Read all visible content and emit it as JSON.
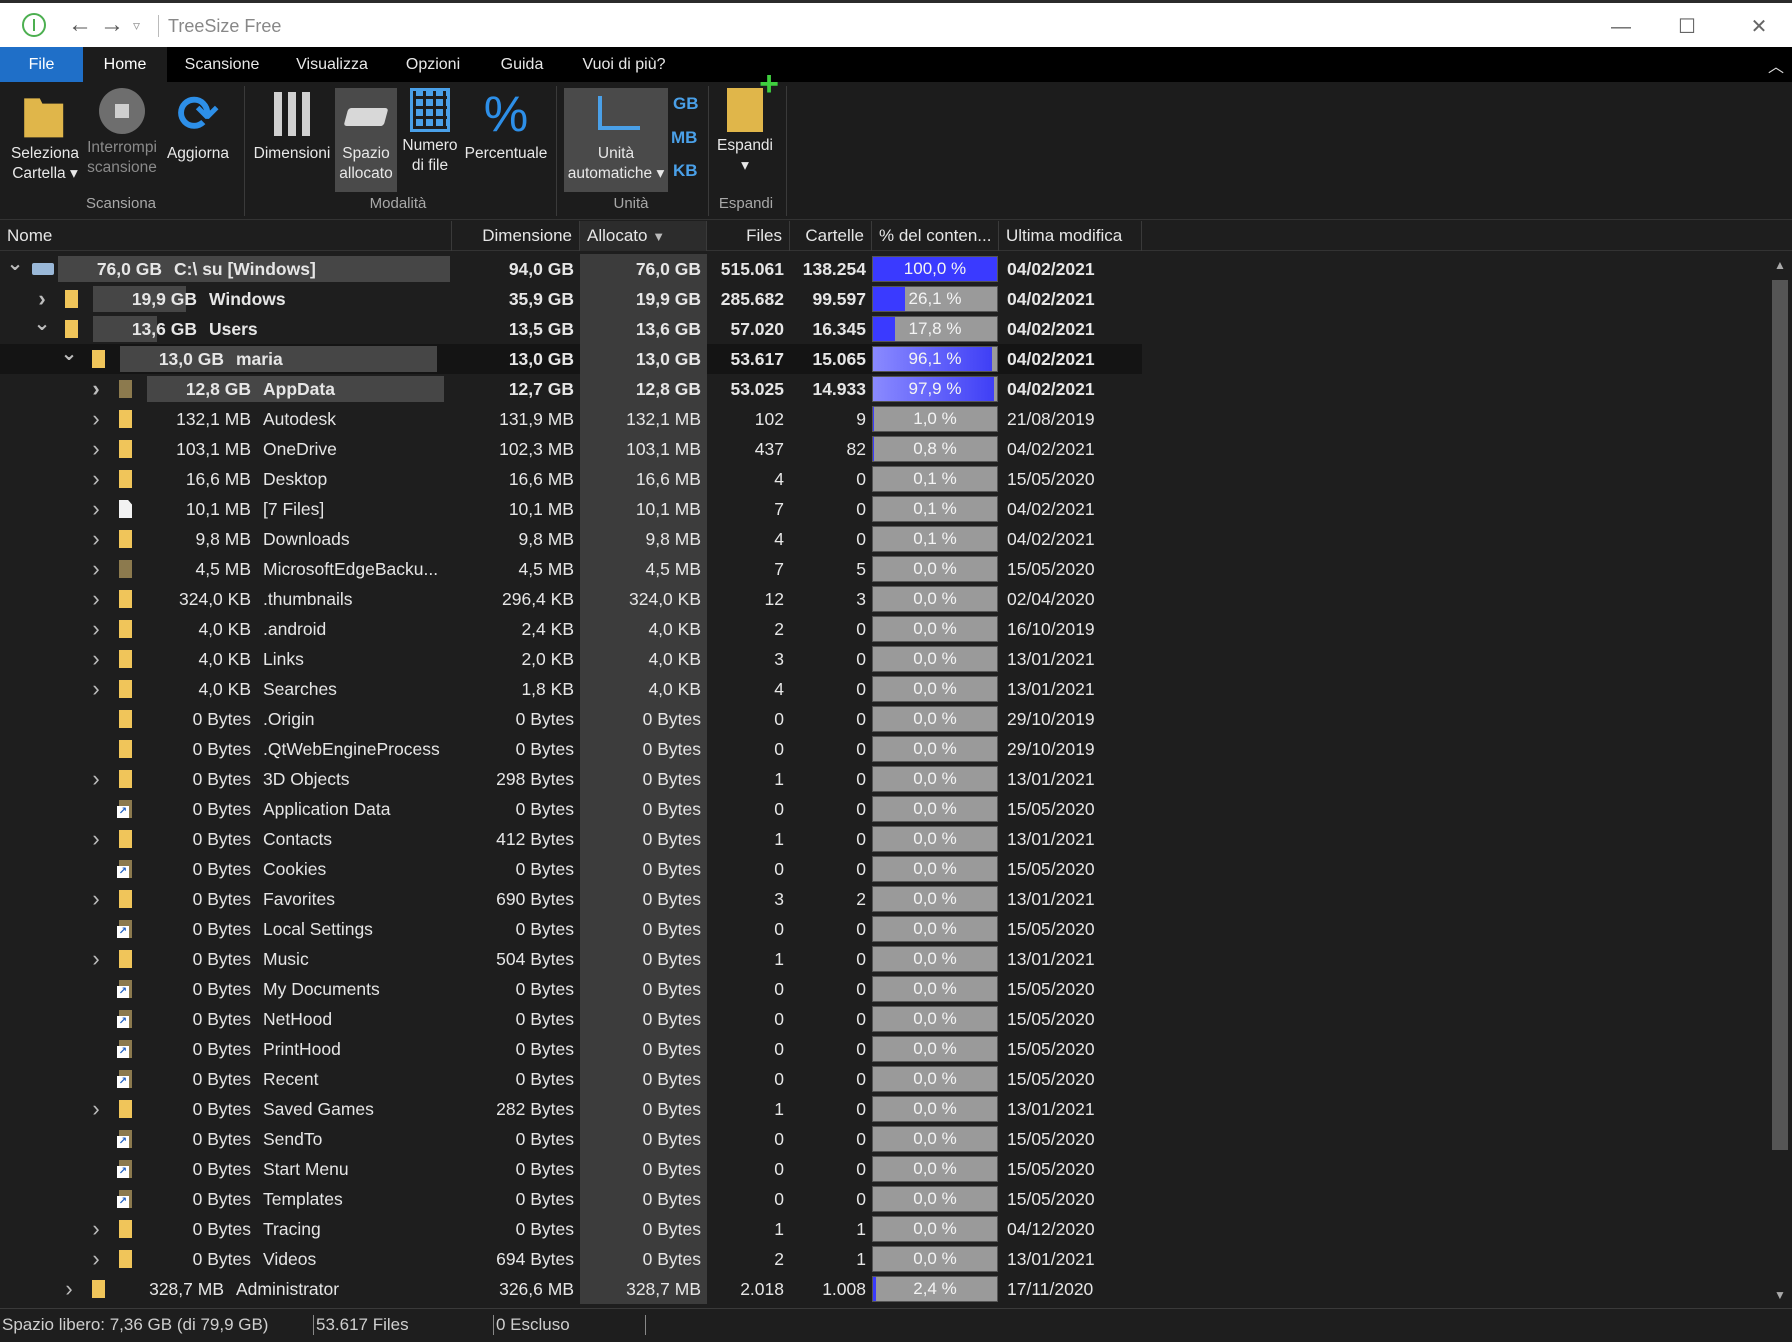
{
  "window": {
    "title": "TreeSize Free"
  },
  "menu": {
    "tabs": [
      "File",
      "Home",
      "Scansione",
      "Visualizza",
      "Opzioni",
      "Guida",
      "Vuoi di più?"
    ],
    "active": "Home"
  },
  "ribbon": {
    "select_folder": "Seleziona Cartella",
    "select_folder_l1": "Seleziona",
    "select_folder_l2": "Cartella",
    "stop_l1": "Interrompi",
    "stop_l2": "scansione",
    "refresh": "Aggiorna",
    "size": "Dimensioni",
    "alloc_l1": "Spazio",
    "alloc_l2": "allocato",
    "files_l1": "Numero",
    "files_l2": "di file",
    "percent": "Percentuale",
    "units_l1": "Unità",
    "units_l2": "automatiche",
    "unit_gb": "GB",
    "unit_mb": "MB",
    "unit_kb": "KB",
    "expand": "Espandi",
    "groups": {
      "scan": "Scansiona",
      "mode": "Modalità",
      "unit": "Unità",
      "expand": "Espandi"
    }
  },
  "columns": {
    "name": "Nome",
    "size": "Dimensione",
    "allocated": "Allocato",
    "files": "Files",
    "folders": "Cartelle",
    "percent": "% del conten...",
    "modified": "Ultima modifica"
  },
  "rows": [
    {
      "level": 0,
      "chev": "v",
      "icon": "drive",
      "bar": 1.0,
      "alloc": "76,0 GB",
      "name": "C:\\  su  [Windows]",
      "size": "94,0 GB",
      "allocated": "76,0 GB",
      "files": "515.061",
      "folders": "138.254",
      "pct": 1.0,
      "pct_label": "100,0 %",
      "date": "04/02/2021",
      "bold": true
    },
    {
      "level": 1,
      "chev": ">",
      "icon": "folder",
      "bar": 0.261,
      "alloc": "19,9 GB",
      "name": "Windows",
      "size": "35,9 GB",
      "allocated": "19,9 GB",
      "files": "285.682",
      "folders": "99.597",
      "pct": 0.261,
      "pct_label": "26,1 %",
      "date": "04/02/2021",
      "bold": true
    },
    {
      "level": 1,
      "chev": "v",
      "icon": "folder",
      "bar": 0.178,
      "alloc": "13,6 GB",
      "name": "Users",
      "size": "13,5 GB",
      "allocated": "13,6 GB",
      "files": "57.020",
      "folders": "16.345",
      "pct": 0.178,
      "pct_label": "17,8 %",
      "date": "04/02/2021",
      "bold": true
    },
    {
      "level": 2,
      "chev": "v",
      "icon": "folder",
      "bar": 0.961,
      "alloc": "13,0 GB",
      "name": "maria",
      "size": "13,0 GB",
      "allocated": "13,0 GB",
      "files": "53.617",
      "folders": "15.065",
      "pct": 0.961,
      "pct_label": "96,1 %",
      "date": "04/02/2021",
      "bold": true,
      "selected": true
    },
    {
      "level": 3,
      "chev": ">",
      "icon": "folder-dark",
      "bar": 0.979,
      "alloc": "12,8 GB",
      "name": "AppData",
      "size": "12,7 GB",
      "allocated": "12,8 GB",
      "files": "53.025",
      "folders": "14.933",
      "pct": 0.979,
      "pct_label": "97,9 %",
      "date": "04/02/2021",
      "bold": true
    },
    {
      "level": 3,
      "chev": ">",
      "icon": "folder",
      "bar": 0.01,
      "alloc": "132,1 MB",
      "name": "Autodesk",
      "size": "131,9 MB",
      "allocated": "132,1 MB",
      "files": "102",
      "folders": "9",
      "pct": 0.01,
      "pct_label": "1,0 %",
      "date": "21/08/2019"
    },
    {
      "level": 3,
      "chev": ">",
      "icon": "folder",
      "bar": 0.008,
      "alloc": "103,1 MB",
      "name": "OneDrive",
      "size": "102,3 MB",
      "allocated": "103,1 MB",
      "files": "437",
      "folders": "82",
      "pct": 0.008,
      "pct_label": "0,8 %",
      "date": "04/02/2021"
    },
    {
      "level": 3,
      "chev": ">",
      "icon": "folder",
      "bar": 0.001,
      "alloc": "16,6 MB",
      "name": "Desktop",
      "size": "16,6 MB",
      "allocated": "16,6 MB",
      "files": "4",
      "folders": "0",
      "pct": 0.001,
      "pct_label": "0,1 %",
      "date": "15/05/2020"
    },
    {
      "level": 3,
      "chev": ">",
      "icon": "file",
      "bar": 0.001,
      "alloc": "10,1 MB",
      "name": "[7 Files]",
      "size": "10,1 MB",
      "allocated": "10,1 MB",
      "files": "7",
      "folders": "0",
      "pct": 0.001,
      "pct_label": "0,1 %",
      "date": "04/02/2021"
    },
    {
      "level": 3,
      "chev": ">",
      "icon": "folder",
      "bar": 0.001,
      "alloc": "9,8 MB",
      "name": "Downloads",
      "size": "9,8 MB",
      "allocated": "9,8 MB",
      "files": "4",
      "folders": "0",
      "pct": 0.001,
      "pct_label": "0,1 %",
      "date": "04/02/2021"
    },
    {
      "level": 3,
      "chev": ">",
      "icon": "folder-dark",
      "bar": 0.0,
      "alloc": "4,5 MB",
      "name": "MicrosoftEdgeBacku...",
      "size": "4,5 MB",
      "allocated": "4,5 MB",
      "files": "7",
      "folders": "5",
      "pct": 0.0,
      "pct_label": "0,0 %",
      "date": "15/05/2020"
    },
    {
      "level": 3,
      "chev": ">",
      "icon": "folder",
      "bar": 0.0,
      "alloc": "324,0 KB",
      "name": ".thumbnails",
      "size": "296,4 KB",
      "allocated": "324,0 KB",
      "files": "12",
      "folders": "3",
      "pct": 0.0,
      "pct_label": "0,0 %",
      "date": "02/04/2020"
    },
    {
      "level": 3,
      "chev": ">",
      "icon": "folder",
      "bar": 0.0,
      "alloc": "4,0 KB",
      "name": ".android",
      "size": "2,4 KB",
      "allocated": "4,0 KB",
      "files": "2",
      "folders": "0",
      "pct": 0.0,
      "pct_label": "0,0 %",
      "date": "16/10/2019"
    },
    {
      "level": 3,
      "chev": ">",
      "icon": "folder",
      "bar": 0.0,
      "alloc": "4,0 KB",
      "name": "Links",
      "size": "2,0 KB",
      "allocated": "4,0 KB",
      "files": "3",
      "folders": "0",
      "pct": 0.0,
      "pct_label": "0,0 %",
      "date": "13/01/2021"
    },
    {
      "level": 3,
      "chev": ">",
      "icon": "folder",
      "bar": 0.0,
      "alloc": "4,0 KB",
      "name": "Searches",
      "size": "1,8 KB",
      "allocated": "4,0 KB",
      "files": "4",
      "folders": "0",
      "pct": 0.0,
      "pct_label": "0,0 %",
      "date": "13/01/2021"
    },
    {
      "level": 3,
      "chev": "",
      "icon": "folder",
      "bar": 0.0,
      "alloc": "0 Bytes",
      "name": ".Origin",
      "size": "0 Bytes",
      "allocated": "0 Bytes",
      "files": "0",
      "folders": "0",
      "pct": 0.0,
      "pct_label": "0,0 %",
      "date": "29/10/2019"
    },
    {
      "level": 3,
      "chev": "",
      "icon": "folder",
      "bar": 0.0,
      "alloc": "0 Bytes",
      "name": ".QtWebEngineProcess",
      "size": "0 Bytes",
      "allocated": "0 Bytes",
      "files": "0",
      "folders": "0",
      "pct": 0.0,
      "pct_label": "0,0 %",
      "date": "29/10/2019"
    },
    {
      "level": 3,
      "chev": ">",
      "icon": "folder",
      "bar": 0.0,
      "alloc": "0 Bytes",
      "name": "3D Objects",
      "size": "298 Bytes",
      "allocated": "0 Bytes",
      "files": "1",
      "folders": "0",
      "pct": 0.0,
      "pct_label": "0,0 %",
      "date": "13/01/2021"
    },
    {
      "level": 3,
      "chev": "",
      "icon": "link",
      "bar": 0.0,
      "alloc": "0 Bytes",
      "name": "Application Data",
      "size": "0 Bytes",
      "allocated": "0 Bytes",
      "files": "0",
      "folders": "0",
      "pct": 0.0,
      "pct_label": "0,0 %",
      "date": "15/05/2020"
    },
    {
      "level": 3,
      "chev": ">",
      "icon": "folder",
      "bar": 0.0,
      "alloc": "0 Bytes",
      "name": "Contacts",
      "size": "412 Bytes",
      "allocated": "0 Bytes",
      "files": "1",
      "folders": "0",
      "pct": 0.0,
      "pct_label": "0,0 %",
      "date": "13/01/2021"
    },
    {
      "level": 3,
      "chev": "",
      "icon": "link",
      "bar": 0.0,
      "alloc": "0 Bytes",
      "name": "Cookies",
      "size": "0 Bytes",
      "allocated": "0 Bytes",
      "files": "0",
      "folders": "0",
      "pct": 0.0,
      "pct_label": "0,0 %",
      "date": "15/05/2020"
    },
    {
      "level": 3,
      "chev": ">",
      "icon": "folder",
      "bar": 0.0,
      "alloc": "0 Bytes",
      "name": "Favorites",
      "size": "690 Bytes",
      "allocated": "0 Bytes",
      "files": "3",
      "folders": "2",
      "pct": 0.0,
      "pct_label": "0,0 %",
      "date": "13/01/2021"
    },
    {
      "level": 3,
      "chev": "",
      "icon": "link",
      "bar": 0.0,
      "alloc": "0 Bytes",
      "name": "Local Settings",
      "size": "0 Bytes",
      "allocated": "0 Bytes",
      "files": "0",
      "folders": "0",
      "pct": 0.0,
      "pct_label": "0,0 %",
      "date": "15/05/2020"
    },
    {
      "level": 3,
      "chev": ">",
      "icon": "folder",
      "bar": 0.0,
      "alloc": "0 Bytes",
      "name": "Music",
      "size": "504 Bytes",
      "allocated": "0 Bytes",
      "files": "1",
      "folders": "0",
      "pct": 0.0,
      "pct_label": "0,0 %",
      "date": "13/01/2021"
    },
    {
      "level": 3,
      "chev": "",
      "icon": "link",
      "bar": 0.0,
      "alloc": "0 Bytes",
      "name": "My Documents",
      "size": "0 Bytes",
      "allocated": "0 Bytes",
      "files": "0",
      "folders": "0",
      "pct": 0.0,
      "pct_label": "0,0 %",
      "date": "15/05/2020"
    },
    {
      "level": 3,
      "chev": "",
      "icon": "link",
      "bar": 0.0,
      "alloc": "0 Bytes",
      "name": "NetHood",
      "size": "0 Bytes",
      "allocated": "0 Bytes",
      "files": "0",
      "folders": "0",
      "pct": 0.0,
      "pct_label": "0,0 %",
      "date": "15/05/2020"
    },
    {
      "level": 3,
      "chev": "",
      "icon": "link",
      "bar": 0.0,
      "alloc": "0 Bytes",
      "name": "PrintHood",
      "size": "0 Bytes",
      "allocated": "0 Bytes",
      "files": "0",
      "folders": "0",
      "pct": 0.0,
      "pct_label": "0,0 %",
      "date": "15/05/2020"
    },
    {
      "level": 3,
      "chev": "",
      "icon": "link",
      "bar": 0.0,
      "alloc": "0 Bytes",
      "name": "Recent",
      "size": "0 Bytes",
      "allocated": "0 Bytes",
      "files": "0",
      "folders": "0",
      "pct": 0.0,
      "pct_label": "0,0 %",
      "date": "15/05/2020"
    },
    {
      "level": 3,
      "chev": ">",
      "icon": "folder",
      "bar": 0.0,
      "alloc": "0 Bytes",
      "name": "Saved Games",
      "size": "282 Bytes",
      "allocated": "0 Bytes",
      "files": "1",
      "folders": "0",
      "pct": 0.0,
      "pct_label": "0,0 %",
      "date": "13/01/2021"
    },
    {
      "level": 3,
      "chev": "",
      "icon": "link",
      "bar": 0.0,
      "alloc": "0 Bytes",
      "name": "SendTo",
      "size": "0 Bytes",
      "allocated": "0 Bytes",
      "files": "0",
      "folders": "0",
      "pct": 0.0,
      "pct_label": "0,0 %",
      "date": "15/05/2020"
    },
    {
      "level": 3,
      "chev": "",
      "icon": "link",
      "bar": 0.0,
      "alloc": "0 Bytes",
      "name": "Start Menu",
      "size": "0 Bytes",
      "allocated": "0 Bytes",
      "files": "0",
      "folders": "0",
      "pct": 0.0,
      "pct_label": "0,0 %",
      "date": "15/05/2020"
    },
    {
      "level": 3,
      "chev": "",
      "icon": "link",
      "bar": 0.0,
      "alloc": "0 Bytes",
      "name": "Templates",
      "size": "0 Bytes",
      "allocated": "0 Bytes",
      "files": "0",
      "folders": "0",
      "pct": 0.0,
      "pct_label": "0,0 %",
      "date": "15/05/2020"
    },
    {
      "level": 3,
      "chev": ">",
      "icon": "folder",
      "bar": 0.0,
      "alloc": "0 Bytes",
      "name": "Tracing",
      "size": "0 Bytes",
      "allocated": "0 Bytes",
      "files": "1",
      "folders": "1",
      "pct": 0.0,
      "pct_label": "0,0 %",
      "date": "04/12/2020"
    },
    {
      "level": 3,
      "chev": ">",
      "icon": "folder",
      "bar": 0.0,
      "alloc": "0 Bytes",
      "name": "Videos",
      "size": "694 Bytes",
      "allocated": "0 Bytes",
      "files": "2",
      "folders": "1",
      "pct": 0.0,
      "pct_label": "0,0 %",
      "date": "13/01/2021"
    },
    {
      "level": 2,
      "chev": ">",
      "icon": "folder",
      "bar": 0.024,
      "alloc": "328,7 MB",
      "name": "Administrator",
      "size": "326,6 MB",
      "allocated": "328,7 MB",
      "files": "2.018",
      "folders": "1.008",
      "pct": 0.024,
      "pct_label": "2,4 %",
      "date": "17/11/2020"
    }
  ],
  "status": {
    "free_space": "Spazio libero: 7,36 GB  (di 79,9 GB)",
    "files": "53.617 Files",
    "excluded": "0 Escluso"
  },
  "colors": {
    "file_tab": "#1f6fc8",
    "accent_blue": "#2d8fe8",
    "pct_bar": "#3a3aff",
    "folder": "#f0c55a"
  }
}
